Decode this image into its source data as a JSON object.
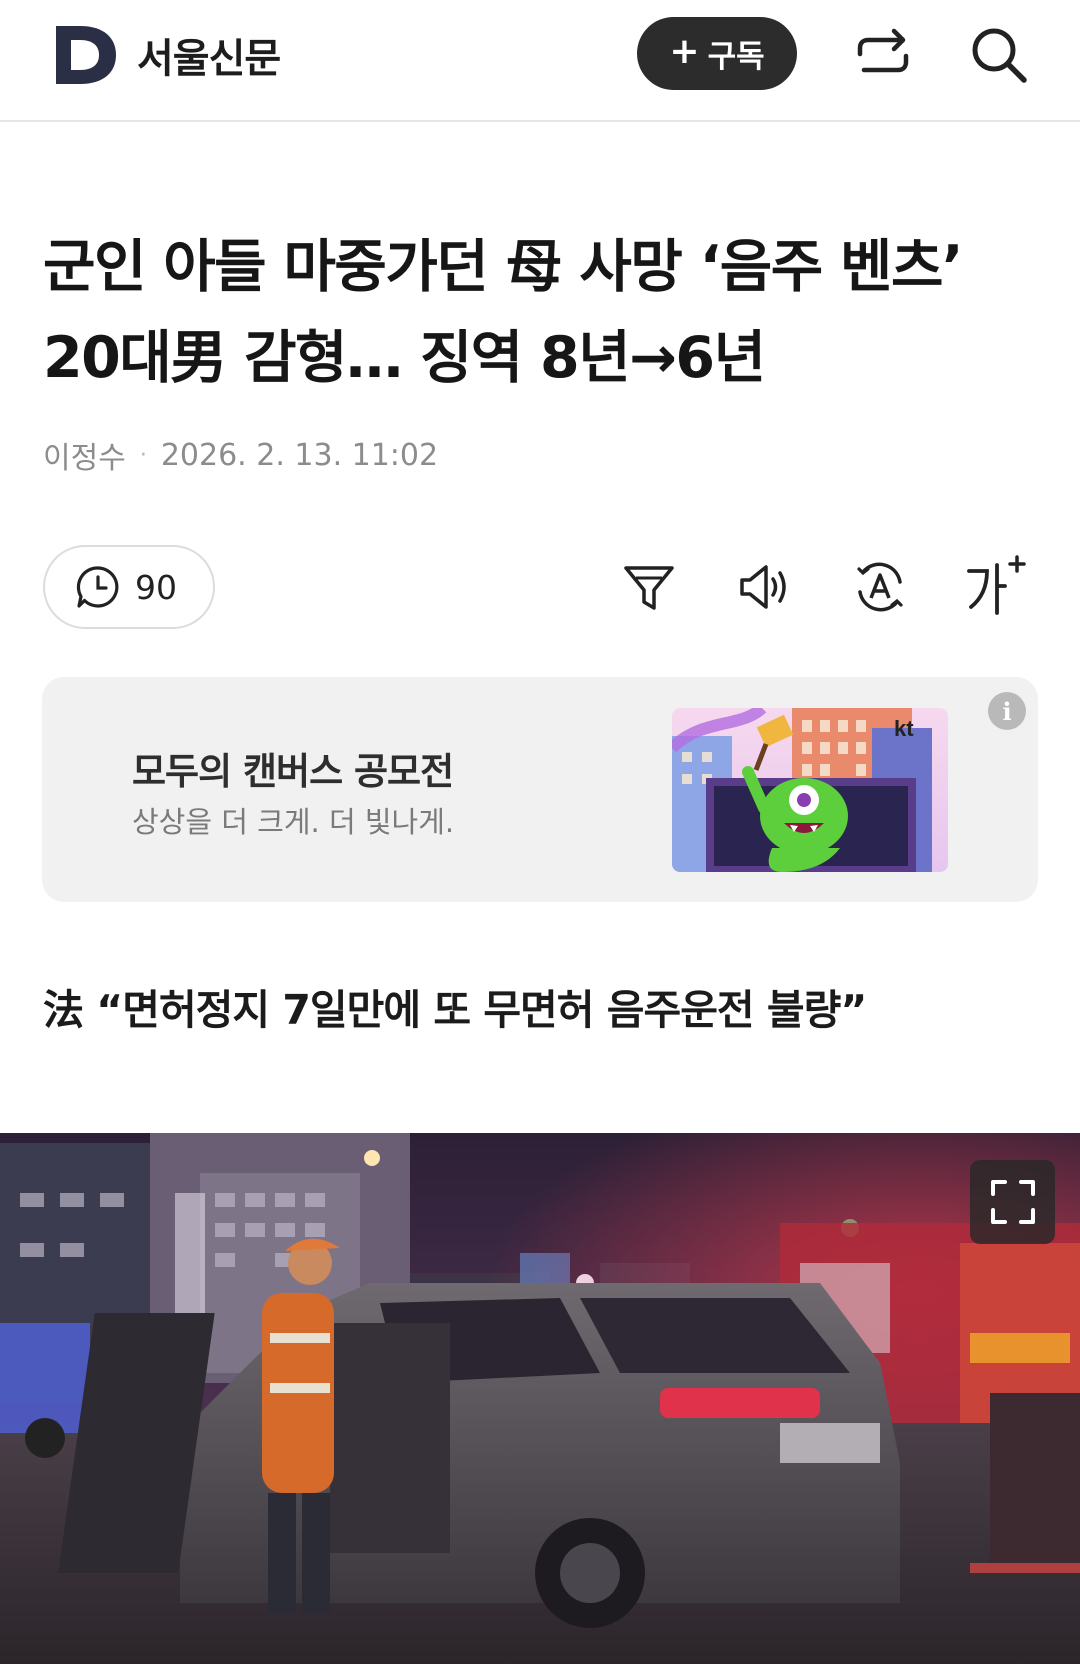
{
  "header": {
    "logo_letter": "D",
    "brand_name": "서울신문",
    "subscribe_label": "구독",
    "subscribe_icon": "plus-icon",
    "share_icon": "share-icon",
    "search_icon": "search-icon"
  },
  "article": {
    "headline": "군인 아들 마중가던 母 사망 ‘음주 벤츠’ 20대男 감형… 징역 8년→6년",
    "author": "이정수",
    "separator": "·",
    "datetime": "2026. 2. 13. 11:02",
    "subheading": "法 “면허정지 7일만에 또 무면허 음주운전 불량”"
  },
  "toolbar": {
    "comment_count": "90",
    "icons": [
      "comment-icon",
      "filter-icon",
      "speaker-icon",
      "translate-icon",
      "font-size-icon"
    ],
    "font_size_label": "가"
  },
  "ad": {
    "title": "모두의 캔버스 공모전",
    "subtitle": "상상을 더 크게. 더 빛나게.",
    "brand_badge": "kt",
    "info_icon": "i"
  },
  "photo": {
    "expand_icon": "fullscreen-icon"
  },
  "colors": {
    "subscribe_bg": "#2c2c2c",
    "logo": "#2a2f45",
    "ad_bg": "#f1f1f1",
    "meta_text": "#8c8c8c"
  }
}
